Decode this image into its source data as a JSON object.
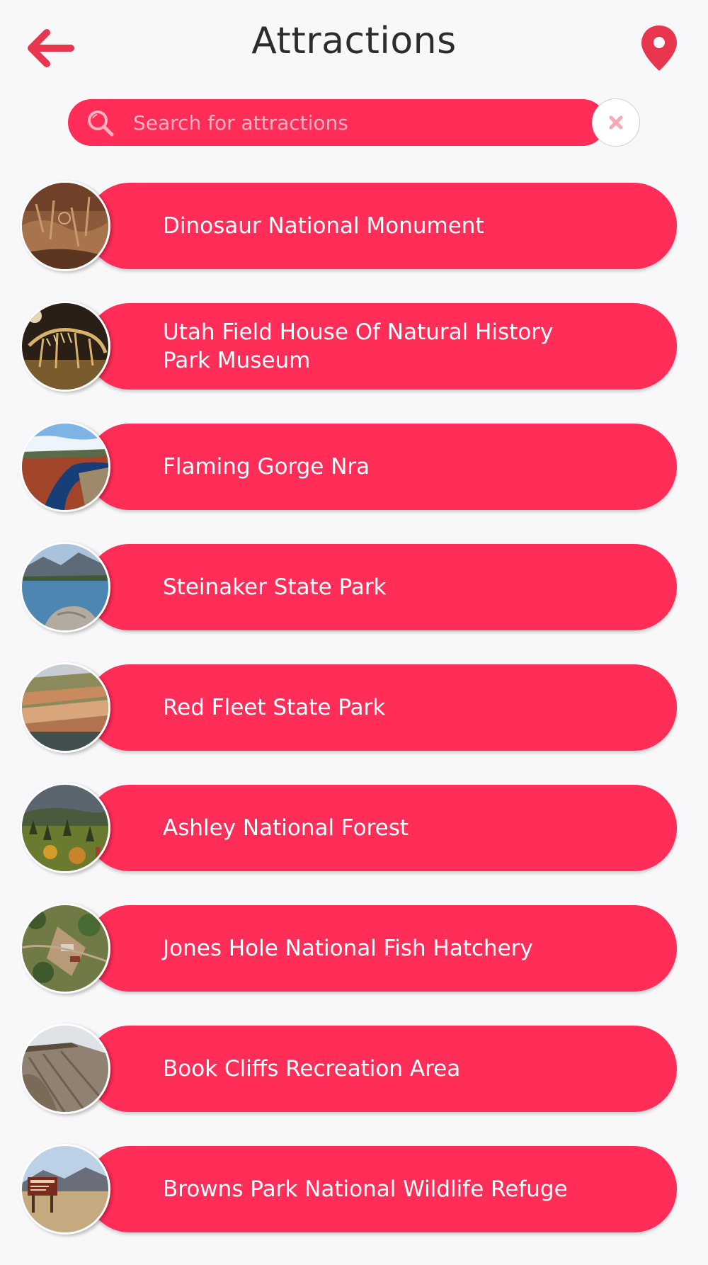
{
  "header": {
    "title": "Attractions",
    "back_icon": "arrow-left-icon",
    "location_icon": "map-pin-icon"
  },
  "search": {
    "placeholder": "Search for attractions",
    "value": "",
    "clear_icon": "close-icon"
  },
  "colors": {
    "accent": "#ff2d58",
    "background": "#f8f8fa",
    "title_text": "#2c2c2a"
  },
  "attractions": [
    {
      "name": "Dinosaur National Monument",
      "thumb": "petroglyph-rock-photo"
    },
    {
      "name": "Utah Field House Of Natural History Park Museum",
      "thumb": "dinosaur-skeleton-photo"
    },
    {
      "name": "Flaming Gorge Nra",
      "thumb": "canyon-river-photo"
    },
    {
      "name": "Steinaker State Park",
      "thumb": "lake-rocks-photo"
    },
    {
      "name": "Red Fleet State Park",
      "thumb": "red-rock-lake-photo"
    },
    {
      "name": "Ashley National Forest",
      "thumb": "forest-hills-photo"
    },
    {
      "name": "Jones Hole National Fish Hatchery",
      "thumb": "aerial-hatchery-photo"
    },
    {
      "name": "Book Cliffs Recreation Area",
      "thumb": "cliffs-photo"
    },
    {
      "name": "Browns Park National Wildlife Refuge",
      "thumb": "refuge-sign-photo"
    }
  ]
}
